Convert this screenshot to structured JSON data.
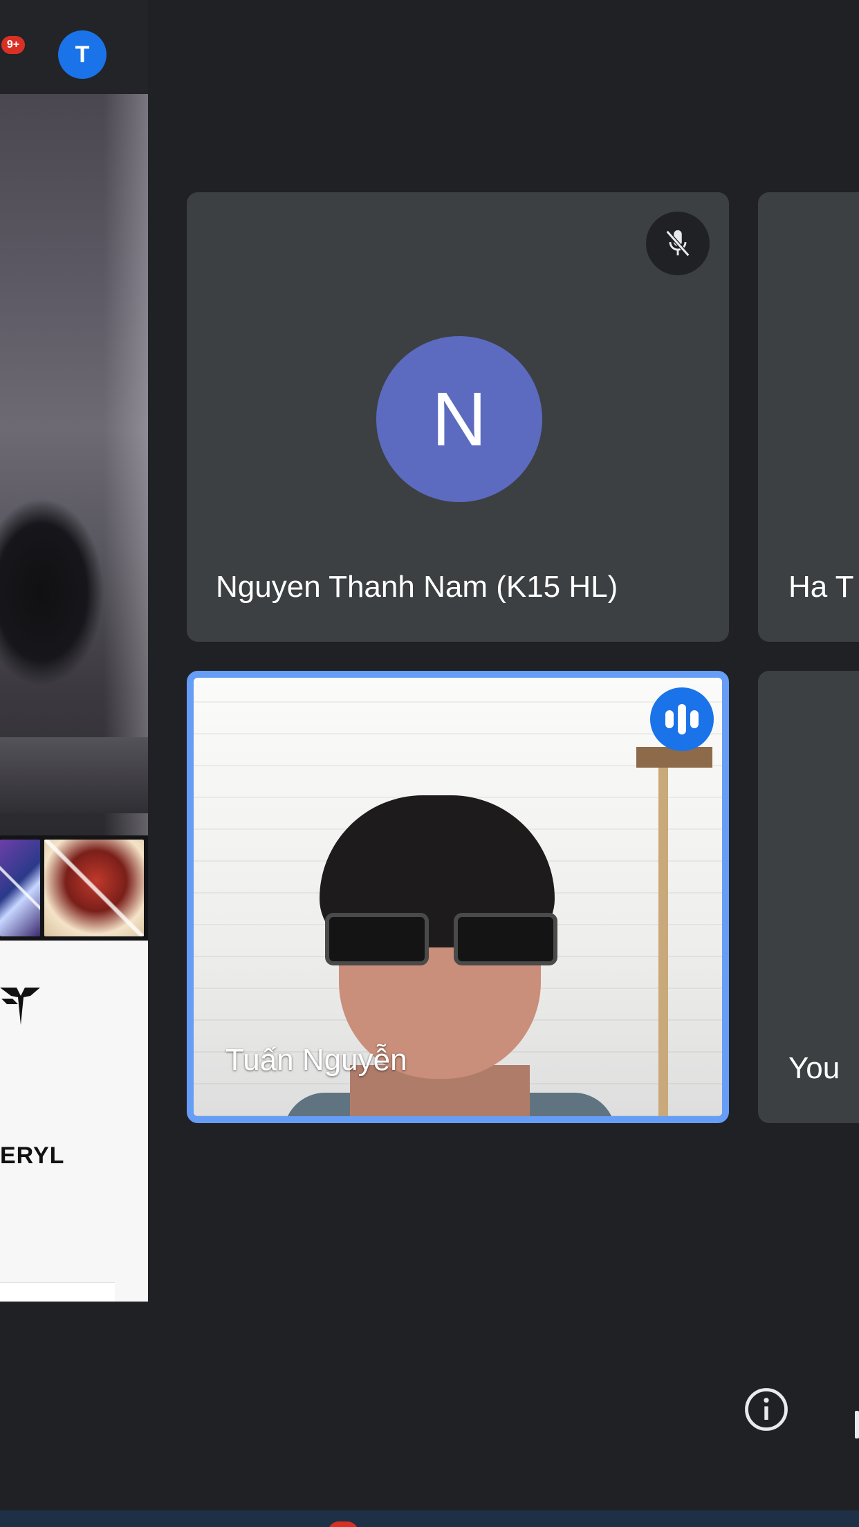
{
  "header": {
    "notification_count": "9+",
    "account_initial": "T"
  },
  "shared_screen": {
    "page_text": "ERYL"
  },
  "participants": [
    {
      "name": "Nguyen Thanh Nam (K15 HL)",
      "initial": "N",
      "muted": true,
      "avatar_color": "#5c6bc0"
    },
    {
      "name": "Ha T",
      "muted": false
    },
    {
      "name": "Tuấn Nguyễn",
      "video_on": true,
      "speaking": true,
      "highlight_color": "#669df6"
    },
    {
      "name": "You",
      "muted": false
    }
  ],
  "controls": {
    "info_icon": "info-icon"
  },
  "colors": {
    "background": "#202124",
    "tile": "#3c4043",
    "speaking": "#1a73e8",
    "badge": "#d93025"
  }
}
